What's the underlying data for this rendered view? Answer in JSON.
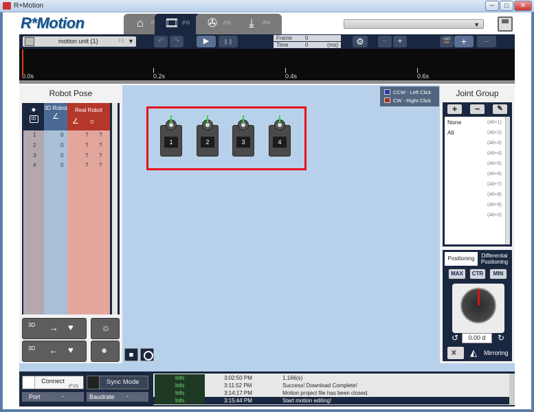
{
  "window": {
    "title": "R+Motion",
    "min": "─",
    "max": "□",
    "close": "✕"
  },
  "header": {
    "logo": "R*Motion",
    "tabs": [
      {
        "icon": "home-icon",
        "glyph": "⌂",
        "key": "(F1)"
      },
      {
        "icon": "film-icon",
        "glyph": "🎞",
        "key": "(F2)"
      },
      {
        "icon": "reel-icon",
        "glyph": "✇",
        "key": "(F3)"
      },
      {
        "icon": "download-icon",
        "glyph": "⤓",
        "key": "(F4)"
      }
    ],
    "combo_value": ""
  },
  "toolbar": {
    "unit_label": "motion unit (1)",
    "unit_minus": "(-)",
    "undo": "↶",
    "redo": "↷",
    "play": "▶",
    "pause": "❚❚",
    "frame_label": "Frame",
    "frame_value": "0",
    "time_label": "Time",
    "time_value": "0",
    "time_unit": "(ms)",
    "gear": "⚙",
    "zoom_out": "−",
    "zoom_in": "+",
    "add": "+",
    "remove": "−"
  },
  "timeline": {
    "ticks": [
      "0.0s",
      "0.2s",
      "0.4s",
      "0.6s"
    ]
  },
  "robot_pose": {
    "title": "Robot Pose",
    "col_id": "ID",
    "col_3d": "3D Robot",
    "col_real": "Real Robot",
    "rows": [
      {
        "id": "1",
        "robot3d": "0",
        "real_a": "?",
        "real_b": "?"
      },
      {
        "id": "2",
        "robot3d": "0",
        "real_a": "?",
        "real_b": "?"
      },
      {
        "id": "3",
        "robot3d": "0",
        "real_a": "?",
        "real_b": "?"
      },
      {
        "id": "4",
        "robot3d": "0",
        "real_a": "?",
        "real_b": "?"
      }
    ],
    "btn_3d": "3D"
  },
  "canvas": {
    "servos": [
      "1",
      "2",
      "3",
      "4"
    ],
    "legend_ccw": "CCW - Left Click",
    "legend_cw": "CW  - Right Click",
    "ccw_color": "#2a3aa8",
    "cw_color": "#a83020"
  },
  "joint_group": {
    "title": "Joint Group",
    "items": [
      {
        "name": "None",
        "key": "(Alt+1)"
      },
      {
        "name": "All",
        "key": "(Alt+2)"
      },
      {
        "name": "",
        "key": "(Alt+3)"
      },
      {
        "name": "",
        "key": "(Alt+4)"
      },
      {
        "name": "",
        "key": "(Alt+5)"
      },
      {
        "name": "",
        "key": "(Alt+6)"
      },
      {
        "name": "",
        "key": "(Alt+7)"
      },
      {
        "name": "",
        "key": "(Alt+8)"
      },
      {
        "name": "",
        "key": "(Alt+9)"
      },
      {
        "name": "",
        "key": "(Alt+0)"
      }
    ]
  },
  "positioning": {
    "tab1": "Positioning",
    "tab2": "Differential Positioning",
    "max": "MAX",
    "ctr": "CTR",
    "min": "MIN",
    "value": "0.00 d",
    "mirroring": "Mirroring"
  },
  "status": {
    "connect": "Connect",
    "connect_key": "(F10)",
    "sync": "Sync Mode",
    "port": "Port",
    "baudrate": "Baudrate",
    "log": [
      {
        "type": "Info",
        "time": "3:02:50 PM",
        "msg": "1.166(s)"
      },
      {
        "type": "Info",
        "time": "3:11:52 PM",
        "msg": "Success! Download Complete!"
      },
      {
        "type": "Info",
        "time": "3:14:17 PM",
        "msg": "Motion project file has been closed."
      },
      {
        "type": "Info",
        "time": "3:15:44 PM",
        "msg": "Start motion editing!"
      }
    ]
  }
}
